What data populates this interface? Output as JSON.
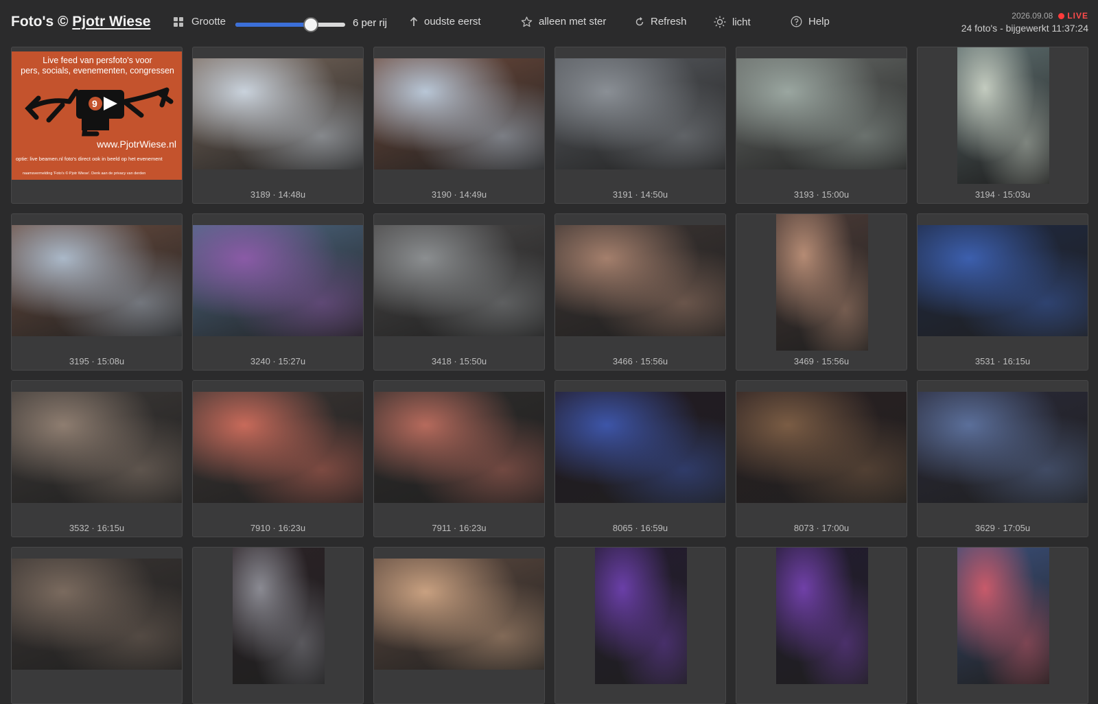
{
  "header": {
    "brand_prefix": "Foto's © ",
    "brand_owner": "Pjotr Wiese",
    "size_label": "Grootte",
    "slider_value": 0.69,
    "per_row_label": "6 per rij",
    "sort_label": "oudste eerst",
    "starred_label": "alleen met ster",
    "refresh_label": "Refresh",
    "theme_label": "licht",
    "help_label": "Help",
    "date": "2026.09.08",
    "live_label": "LIVE",
    "summary": "24 foto's - bijgewerkt 11:37:24",
    "live_color": "#ff3b3b",
    "accent_color": "#3b6fd8"
  },
  "promo": {
    "line1": "Live feed van persfoto's voor",
    "line2": "pers, socials, evenementen, congressen",
    "url": "www.PjotrWiese.nl",
    "option": "optie: live beamen.nl foto's direct ook in beeld op het evenement",
    "credit": "naamsvermelding 'Foto's © Pjotr Wiese'. Denk aan de privacy van derden"
  },
  "photos": [
    {
      "caption": "",
      "icon": "promo-banner"
    },
    {
      "caption": "3189 · 14:48u",
      "icon": "building-flag-photo"
    },
    {
      "caption": "3190 · 14:49u",
      "icon": "building-facade-photo"
    },
    {
      "caption": "3191 · 14:50u",
      "icon": "bicycles-photo"
    },
    {
      "caption": "3193 · 15:00u",
      "icon": "bicycles-square-photo"
    },
    {
      "caption": "3194 · 15:03u",
      "icon": "stained-glass-photo"
    },
    {
      "caption": "3195 · 15:08u",
      "icon": "building-photo"
    },
    {
      "caption": "3240 · 15:27u",
      "icon": "procession-photo"
    },
    {
      "caption": "3418 · 15:50u",
      "icon": "academics-street-photo"
    },
    {
      "caption": "3466 · 15:56u",
      "icon": "church-interior-photo"
    },
    {
      "caption": "3469 · 15:56u",
      "icon": "church-organ-photo"
    },
    {
      "caption": "3531 · 16:15u",
      "icon": "stage-speaker-photo"
    },
    {
      "caption": "3532 · 16:15u",
      "icon": "audience-photo"
    },
    {
      "caption": "7910 · 16:23u",
      "icon": "audience-photo"
    },
    {
      "caption": "7911 · 16:23u",
      "icon": "audience-photo"
    },
    {
      "caption": "8065 · 16:59u",
      "icon": "panel-stage-photo"
    },
    {
      "caption": "8073 · 17:00u",
      "icon": "presenter-photo"
    },
    {
      "caption": "3629 · 17:05u",
      "icon": "panel-stage-photo"
    },
    {
      "caption": "",
      "icon": "panel-stage-photo"
    },
    {
      "caption": "",
      "icon": "speaker-portrait-photo"
    },
    {
      "caption": "",
      "icon": "audience-blur-photo"
    },
    {
      "caption": "",
      "icon": "stage-speaker-photo"
    },
    {
      "caption": "",
      "icon": "lectern-photo"
    },
    {
      "caption": "",
      "icon": "screen-panel-photo"
    }
  ]
}
